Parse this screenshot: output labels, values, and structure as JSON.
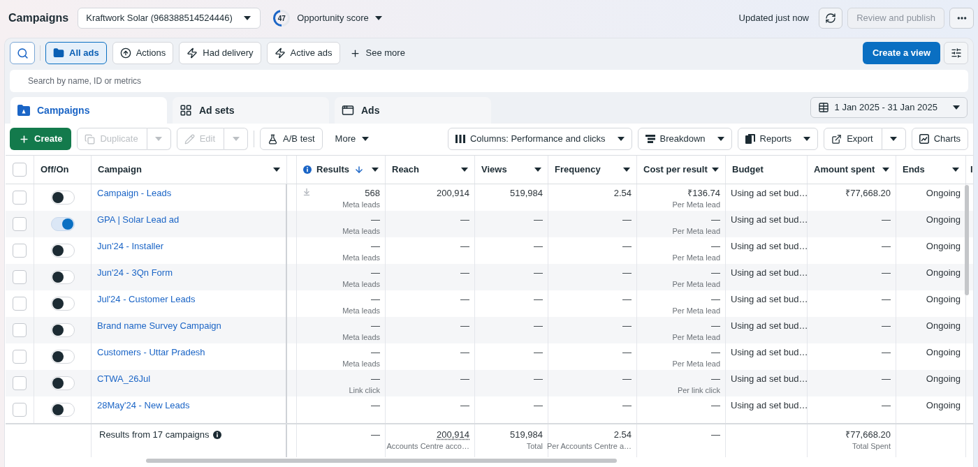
{
  "header": {
    "title": "Campaigns",
    "account": "Kraftwork Solar (968388514524446)",
    "opportunity_score": {
      "value": "47",
      "level": 0.47,
      "label": "Opportunity score"
    },
    "status": "Updated just now",
    "publish_button": {
      "label": "Review and publish",
      "disabled": true
    }
  },
  "filters": {
    "items": [
      {
        "label": "All ads",
        "selected": true
      },
      {
        "label": "Actions",
        "selected": false
      },
      {
        "label": "Had delivery",
        "selected": false
      },
      {
        "label": "Active ads",
        "selected": false
      }
    ],
    "see_more": "See more",
    "create_view": "Create a view",
    "search": {
      "placeholder": "Search by name, ID or metrics"
    }
  },
  "tabs": [
    {
      "label": "Campaigns",
      "selected": true
    },
    {
      "label": "Ad sets",
      "selected": false
    },
    {
      "label": "Ads",
      "selected": false
    }
  ],
  "date_range": "1 Jan 2025 - 31 Jan 2025",
  "toolbar": {
    "left": [
      {
        "kind": "primary",
        "label": "Create",
        "disabled": false
      },
      {
        "kind": "split",
        "label": "Duplicate",
        "disabled": true
      },
      {
        "kind": "split",
        "label": "Edit",
        "disabled": true
      },
      {
        "kind": "outline",
        "label": "A/B test",
        "disabled": false
      },
      {
        "kind": "menu",
        "label": "More",
        "disabled": false
      }
    ],
    "right": [
      {
        "kind": "dropdown",
        "label": "Columns: Performance and clicks",
        "disabled": false
      },
      {
        "kind": "dropdown",
        "label": "Breakdown",
        "disabled": false
      },
      {
        "kind": "dropdown",
        "label": "Reports",
        "disabled": false
      },
      {
        "kind": "split",
        "label": "Export",
        "disabled": false
      },
      {
        "kind": "outline",
        "label": "Charts",
        "disabled": false
      }
    ]
  },
  "table": {
    "select_all": {
      "checked": false
    },
    "columns": [
      {
        "label": "Off/On",
        "menu": false,
        "sorted": false,
        "info": false
      },
      {
        "label": "Campaign",
        "menu": true,
        "sorted": false,
        "info": false
      },
      {
        "label": "Results",
        "menu": true,
        "sorted": true,
        "info": true
      },
      {
        "label": "Reach",
        "menu": true,
        "sorted": false,
        "info": false
      },
      {
        "label": "Views",
        "menu": true,
        "sorted": false,
        "info": false
      },
      {
        "label": "Frequency",
        "menu": true,
        "sorted": false,
        "info": false
      },
      {
        "label": "Cost per result",
        "menu": true,
        "sorted": false,
        "info": false
      },
      {
        "label": "Budget",
        "menu": false,
        "sorted": false,
        "info": false
      },
      {
        "label": "Amount spent",
        "menu": true,
        "sorted": false,
        "info": false
      },
      {
        "label": "Ends",
        "menu": true,
        "sorted": false,
        "info": false
      },
      {
        "label": "I",
        "menu": false,
        "sorted": false,
        "info": false
      }
    ],
    "rows": [
      {
        "checked": false,
        "on": false,
        "name": "Campaign - Leads",
        "results_marker": true,
        "results": "568",
        "results_sub": "Meta leads",
        "reach": "200,914",
        "views": "519,984",
        "frequency": "2.54",
        "cost": "₹136.74",
        "cost_sub": "Per Meta lead",
        "budget": "Using ad set bud…",
        "amount_spent": "₹77,668.20",
        "ends": "Ongoing"
      },
      {
        "checked": false,
        "on": true,
        "name": "GPA | Solar Lead ad",
        "results_marker": false,
        "results": "—",
        "results_sub": "Meta leads",
        "reach": "—",
        "views": "—",
        "frequency": "—",
        "cost": "—",
        "cost_sub": "Per Meta lead",
        "budget": "Using ad set bud…",
        "amount_spent": "—",
        "ends": "Ongoing"
      },
      {
        "checked": false,
        "on": false,
        "name": "Jun'24 - Installer",
        "results_marker": false,
        "results": "—",
        "results_sub": "Meta leads",
        "reach": "—",
        "views": "—",
        "frequency": "—",
        "cost": "—",
        "cost_sub": "Per Meta lead",
        "budget": "Using ad set bud…",
        "amount_spent": "—",
        "ends": "Ongoing"
      },
      {
        "checked": false,
        "on": false,
        "name": "Jun'24 - 3Qn Form",
        "results_marker": false,
        "results": "—",
        "results_sub": "Meta leads",
        "reach": "—",
        "views": "—",
        "frequency": "—",
        "cost": "—",
        "cost_sub": "Per Meta lead",
        "budget": "Using ad set bud…",
        "amount_spent": "—",
        "ends": "Ongoing"
      },
      {
        "checked": false,
        "on": false,
        "name": "Jul'24 - Customer Leads",
        "results_marker": false,
        "results": "—",
        "results_sub": "Meta leads",
        "reach": "—",
        "views": "—",
        "frequency": "—",
        "cost": "—",
        "cost_sub": "Per Meta lead",
        "budget": "Using ad set bud…",
        "amount_spent": "—",
        "ends": "Ongoing"
      },
      {
        "checked": false,
        "on": false,
        "name": "Brand name Survey Campaign",
        "results_marker": false,
        "results": "—",
        "results_sub": "Meta leads",
        "reach": "—",
        "views": "—",
        "frequency": "—",
        "cost": "—",
        "cost_sub": "Per Meta lead",
        "budget": "Using ad set bud…",
        "amount_spent": "—",
        "ends": "Ongoing"
      },
      {
        "checked": false,
        "on": false,
        "name": "Customers - Uttar Pradesh",
        "results_marker": false,
        "results": "—",
        "results_sub": "Meta leads",
        "reach": "—",
        "views": "—",
        "frequency": "—",
        "cost": "—",
        "cost_sub": "Per Meta lead",
        "budget": "Using ad set bud…",
        "amount_spent": "—",
        "ends": "Ongoing"
      },
      {
        "checked": false,
        "on": false,
        "name": "CTWA_26Jul",
        "results_marker": false,
        "results": "—",
        "results_sub": "Link click",
        "reach": "—",
        "views": "—",
        "frequency": "—",
        "cost": "—",
        "cost_sub": "Per link click",
        "budget": "Using ad set bud…",
        "amount_spent": "—",
        "ends": "Ongoing"
      },
      {
        "checked": false,
        "on": false,
        "name": "28May'24 - New Leads",
        "results_marker": false,
        "results": "—",
        "reach": "—",
        "views": "—",
        "frequency": "—",
        "cost": "—",
        "budget": "Using ad set bud…",
        "amount_spent": "—",
        "ends": "Ongoing"
      }
    ],
    "footer": {
      "label": "Results from 17 campaigns",
      "results": "—",
      "reach": {
        "value": "200,914",
        "sub": "Accounts Centre acco…"
      },
      "views": {
        "value": "519,984",
        "sub": "Total"
      },
      "frequency": {
        "value": "2.54",
        "sub": "Per Accounts Centre a…"
      },
      "cost": "—",
      "amount_spent": {
        "value": "₹77,668.20",
        "sub": "Total Spent"
      }
    }
  }
}
